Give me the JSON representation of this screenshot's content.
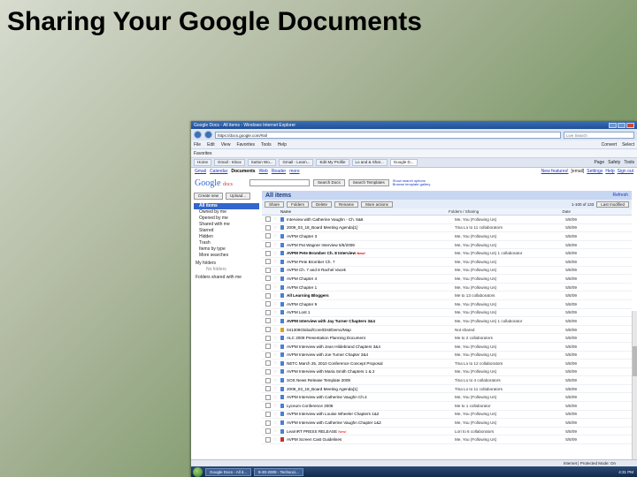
{
  "slide": {
    "title": "Sharing Your Google Documents"
  },
  "ie": {
    "title": "Google Docs - All items - Windows Internet Explorer",
    "url": "https://docs.google.com/#all",
    "search_placeholder": "Live Search",
    "menu": [
      "File",
      "Edit",
      "View",
      "Favorites",
      "Tools",
      "Help"
    ],
    "menu_right": [
      "Convert",
      "Select"
    ],
    "favorites": [
      "Favorites"
    ],
    "tabs": [
      "Home",
      "Gmail - Inbox",
      "Sutton Wo...",
      "Gmail - Learn...",
      "Edit My Profile",
      "Lo and & Shar...",
      "Google D..."
    ],
    "tab_right": [
      "Page",
      "Safety",
      "Tools"
    ]
  },
  "gdocs": {
    "topnav": [
      "Gmail",
      "Calendar",
      "Documents",
      "Web",
      "Reader",
      "more"
    ],
    "topnav_right": [
      "New features!",
      "[email]",
      "Settings",
      "Help",
      "Sign out"
    ],
    "logo": "Google",
    "logo_sub": "docs",
    "search_docs": "Search Docs",
    "search_templates": "Search Templates",
    "search_options": "Show search options",
    "browse_gallery": "Browse template gallery",
    "create_new": "Create new",
    "upload": "Upload...",
    "left_items": [
      "All items",
      "Owned by me",
      "Opened by me",
      "Shared with me",
      "Starred",
      "Hidden",
      "Trash",
      "Items by type",
      "More searches"
    ],
    "my_folders": "My folders",
    "no_folders": "No folders",
    "folders_shared": "Folders shared with me",
    "main_title": "All items",
    "refresh": "Refresh",
    "actions": [
      "Share",
      "Folders",
      "Delete",
      "Rename",
      "More actions"
    ],
    "pager": "1-100 of 133",
    "sort": "Last modified",
    "col_name": "Name",
    "col_folders": "Folders / Sharing",
    "col_date": "Date",
    "rows": [
      {
        "name": "Interview with Catherine Vaughn - Ch. 5&6",
        "share": "Me, You (Following Us)",
        "date": "5/8/09",
        "bold": false,
        "type": "doc"
      },
      {
        "name": "2009_03_18_Board Meeting Agenda[1]",
        "share": "Tina Lo to 11 collaborators",
        "date": "5/8/09",
        "bold": false,
        "type": "doc"
      },
      {
        "name": "AVPM Chapter 3",
        "share": "Me, You (Following Us)",
        "date": "5/8/09",
        "bold": false,
        "type": "doc"
      },
      {
        "name": "AVPM Pat Wagner Interview 5/6/2009",
        "share": "Me, You (Following Us)",
        "date": "5/8/09",
        "bold": false,
        "type": "doc"
      },
      {
        "name": "AVPM Pete Bromber Ch. 8 Interview",
        "share": "Me, You (Following Us) 1 collaborator",
        "date": "5/8/09",
        "bold": true,
        "type": "doc",
        "new": "New!"
      },
      {
        "name": "AVPM Pete Bromber Ch. 7",
        "share": "Me, You (Following Us)",
        "date": "5/8/09",
        "bold": false,
        "type": "doc"
      },
      {
        "name": "AVPM Ch. 7 and 8 Rachel Vacek",
        "share": "Me, You (Following Us)",
        "date": "5/8/09",
        "bold": false,
        "type": "doc"
      },
      {
        "name": "AVPM Chapter 4",
        "share": "Me, You (Following Us)",
        "date": "5/8/09",
        "bold": false,
        "type": "doc"
      },
      {
        "name": "AVPM Chapter 1",
        "share": "Me, You (Following Us)",
        "date": "5/8/09",
        "bold": false,
        "type": "doc"
      },
      {
        "name": "All Learning Bloggers",
        "share": "Me to 13 collaborators",
        "date": "5/8/09",
        "bold": true,
        "type": "doc"
      },
      {
        "name": "AVPM Chapter 9",
        "share": "Me, You (Following Us)",
        "date": "5/8/09",
        "bold": false,
        "type": "doc"
      },
      {
        "name": "AVPM Lost 1",
        "share": "Me, You (Following Us)",
        "date": "5/8/09",
        "bold": false,
        "type": "doc"
      },
      {
        "name": "AVPM Interview with Jay Turner Chapters 3&4",
        "share": "Me, You (Following Us) 1 collaborator",
        "date": "5/8/09",
        "bold": true,
        "type": "doc"
      },
      {
        "name": "041309Global/Core/Dist/Demo/Map",
        "share": "Not shared",
        "date": "5/8/09",
        "bold": false,
        "type": "pres"
      },
      {
        "name": "ALC 2009 Presentation Planning Document",
        "share": "Me to 2 collaborators",
        "date": "5/8/09",
        "bold": false,
        "type": "doc"
      },
      {
        "name": "AVPM Interview with Jean Hildebrand Chapters 3&4",
        "share": "Me, You (Following Us)",
        "date": "5/8/09",
        "bold": false,
        "type": "doc"
      },
      {
        "name": "AVPM Interview with Joe Turner Chapter 3&4",
        "share": "Me, You (Following Us)",
        "date": "5/8/09",
        "bold": false,
        "type": "doc"
      },
      {
        "name": "NETC March 25, 2010 Conference Concept Proposal",
        "share": "Tina Lo to 12 collaborators",
        "date": "5/8/09",
        "bold": false,
        "type": "doc"
      },
      {
        "name": "AVPM Interview with Maria Smith Chapters 1 & 2",
        "share": "Me, You (Following Us)",
        "date": "5/8/09",
        "bold": false,
        "type": "doc"
      },
      {
        "name": "SOS News Release Template 2009",
        "share": "Tina Lo to 4 collaborators",
        "date": "5/8/09",
        "bold": false,
        "type": "doc"
      },
      {
        "name": "2009_03_18_Board Meeting Agenda[1]",
        "share": "Tina Lo to 11 collaborators",
        "date": "5/8/09",
        "bold": false,
        "type": "doc"
      },
      {
        "name": "AVPM Interview with Catherine Vaughn Ch.4",
        "share": "Me, You (Following Us)",
        "date": "5/8/09",
        "bold": false,
        "type": "doc"
      },
      {
        "name": "Lyceum Conference 2008",
        "share": "Me to 1 collaborator",
        "date": "5/8/09",
        "bold": false,
        "type": "doc"
      },
      {
        "name": "AVPM Interview with Louise Wheeler Chapters 1&2",
        "share": "Me, You (Following Us)",
        "date": "5/8/09",
        "bold": false,
        "type": "doc"
      },
      {
        "name": "AVPM Interview with Catherine Vaughn Chapter 1&2",
        "share": "Me, You (Following Us)",
        "date": "5/8/09",
        "bold": false,
        "type": "doc"
      },
      {
        "name": "LearnRT PRESS RELEASE",
        "share": "Lori to 6 collaborators",
        "date": "5/8/09",
        "bold": false,
        "type": "doc",
        "new": "New!"
      },
      {
        "name": "AVPM Screen Cast Guidelines",
        "share": "Me, You (Following Us)",
        "date": "5/8/09",
        "bold": false,
        "type": "pdf"
      }
    ]
  },
  "status": {
    "zone": "Internet | Protected Mode: On"
  },
  "taskbar": {
    "items": [
      "Google Docs - All it...",
      "9-30-2009 - Techsoci..."
    ],
    "clock": "4:31 PM"
  },
  "colors": {
    "gdocs_blue": "#3366cc",
    "header_blue": "#c7d7f2"
  }
}
